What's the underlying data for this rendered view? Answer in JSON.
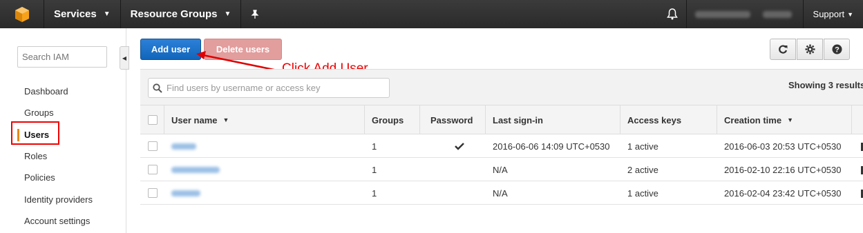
{
  "topnav": {
    "services_label": "Services",
    "resource_groups_label": "Resource Groups",
    "support_label": "Support"
  },
  "sidebar": {
    "search_placeholder": "Search IAM",
    "items": [
      {
        "label": "Dashboard"
      },
      {
        "label": "Groups"
      },
      {
        "label": "Users",
        "active": true
      },
      {
        "label": "Roles"
      },
      {
        "label": "Policies"
      },
      {
        "label": "Identity providers"
      },
      {
        "label": "Account settings"
      }
    ]
  },
  "toolbar": {
    "add_user_label": "Add user",
    "delete_users_label": "Delete users"
  },
  "annotation": {
    "text": "Click Add User",
    "color": "#e00000"
  },
  "filter": {
    "placeholder": "Find users by username or access key",
    "showing_text": "Showing 3 results"
  },
  "table": {
    "headers": {
      "username": "User name",
      "groups": "Groups",
      "password": "Password",
      "last_signin": "Last sign-in",
      "access_keys": "Access keys",
      "creation_time": "Creation time"
    },
    "rows": [
      {
        "groups": "1",
        "password": true,
        "last_signin": "2016-06-06 14:09 UTC+0530",
        "access_keys": "1 active",
        "creation_time": "2016-06-03 20:53 UTC+0530"
      },
      {
        "groups": "1",
        "password": false,
        "last_signin": "N/A",
        "access_keys": "2 active",
        "creation_time": "2016-02-10 22:16 UTC+0530"
      },
      {
        "groups": "1",
        "password": false,
        "last_signin": "N/A",
        "access_keys": "1 active",
        "creation_time": "2016-02-04 23:42 UTC+0530"
      }
    ]
  },
  "colors": {
    "topbar": "#2a2a2a",
    "primary_button": "#1a73c9",
    "danger_button_disabled": "#e29d9d",
    "active_nav_marker": "#e8890c"
  }
}
